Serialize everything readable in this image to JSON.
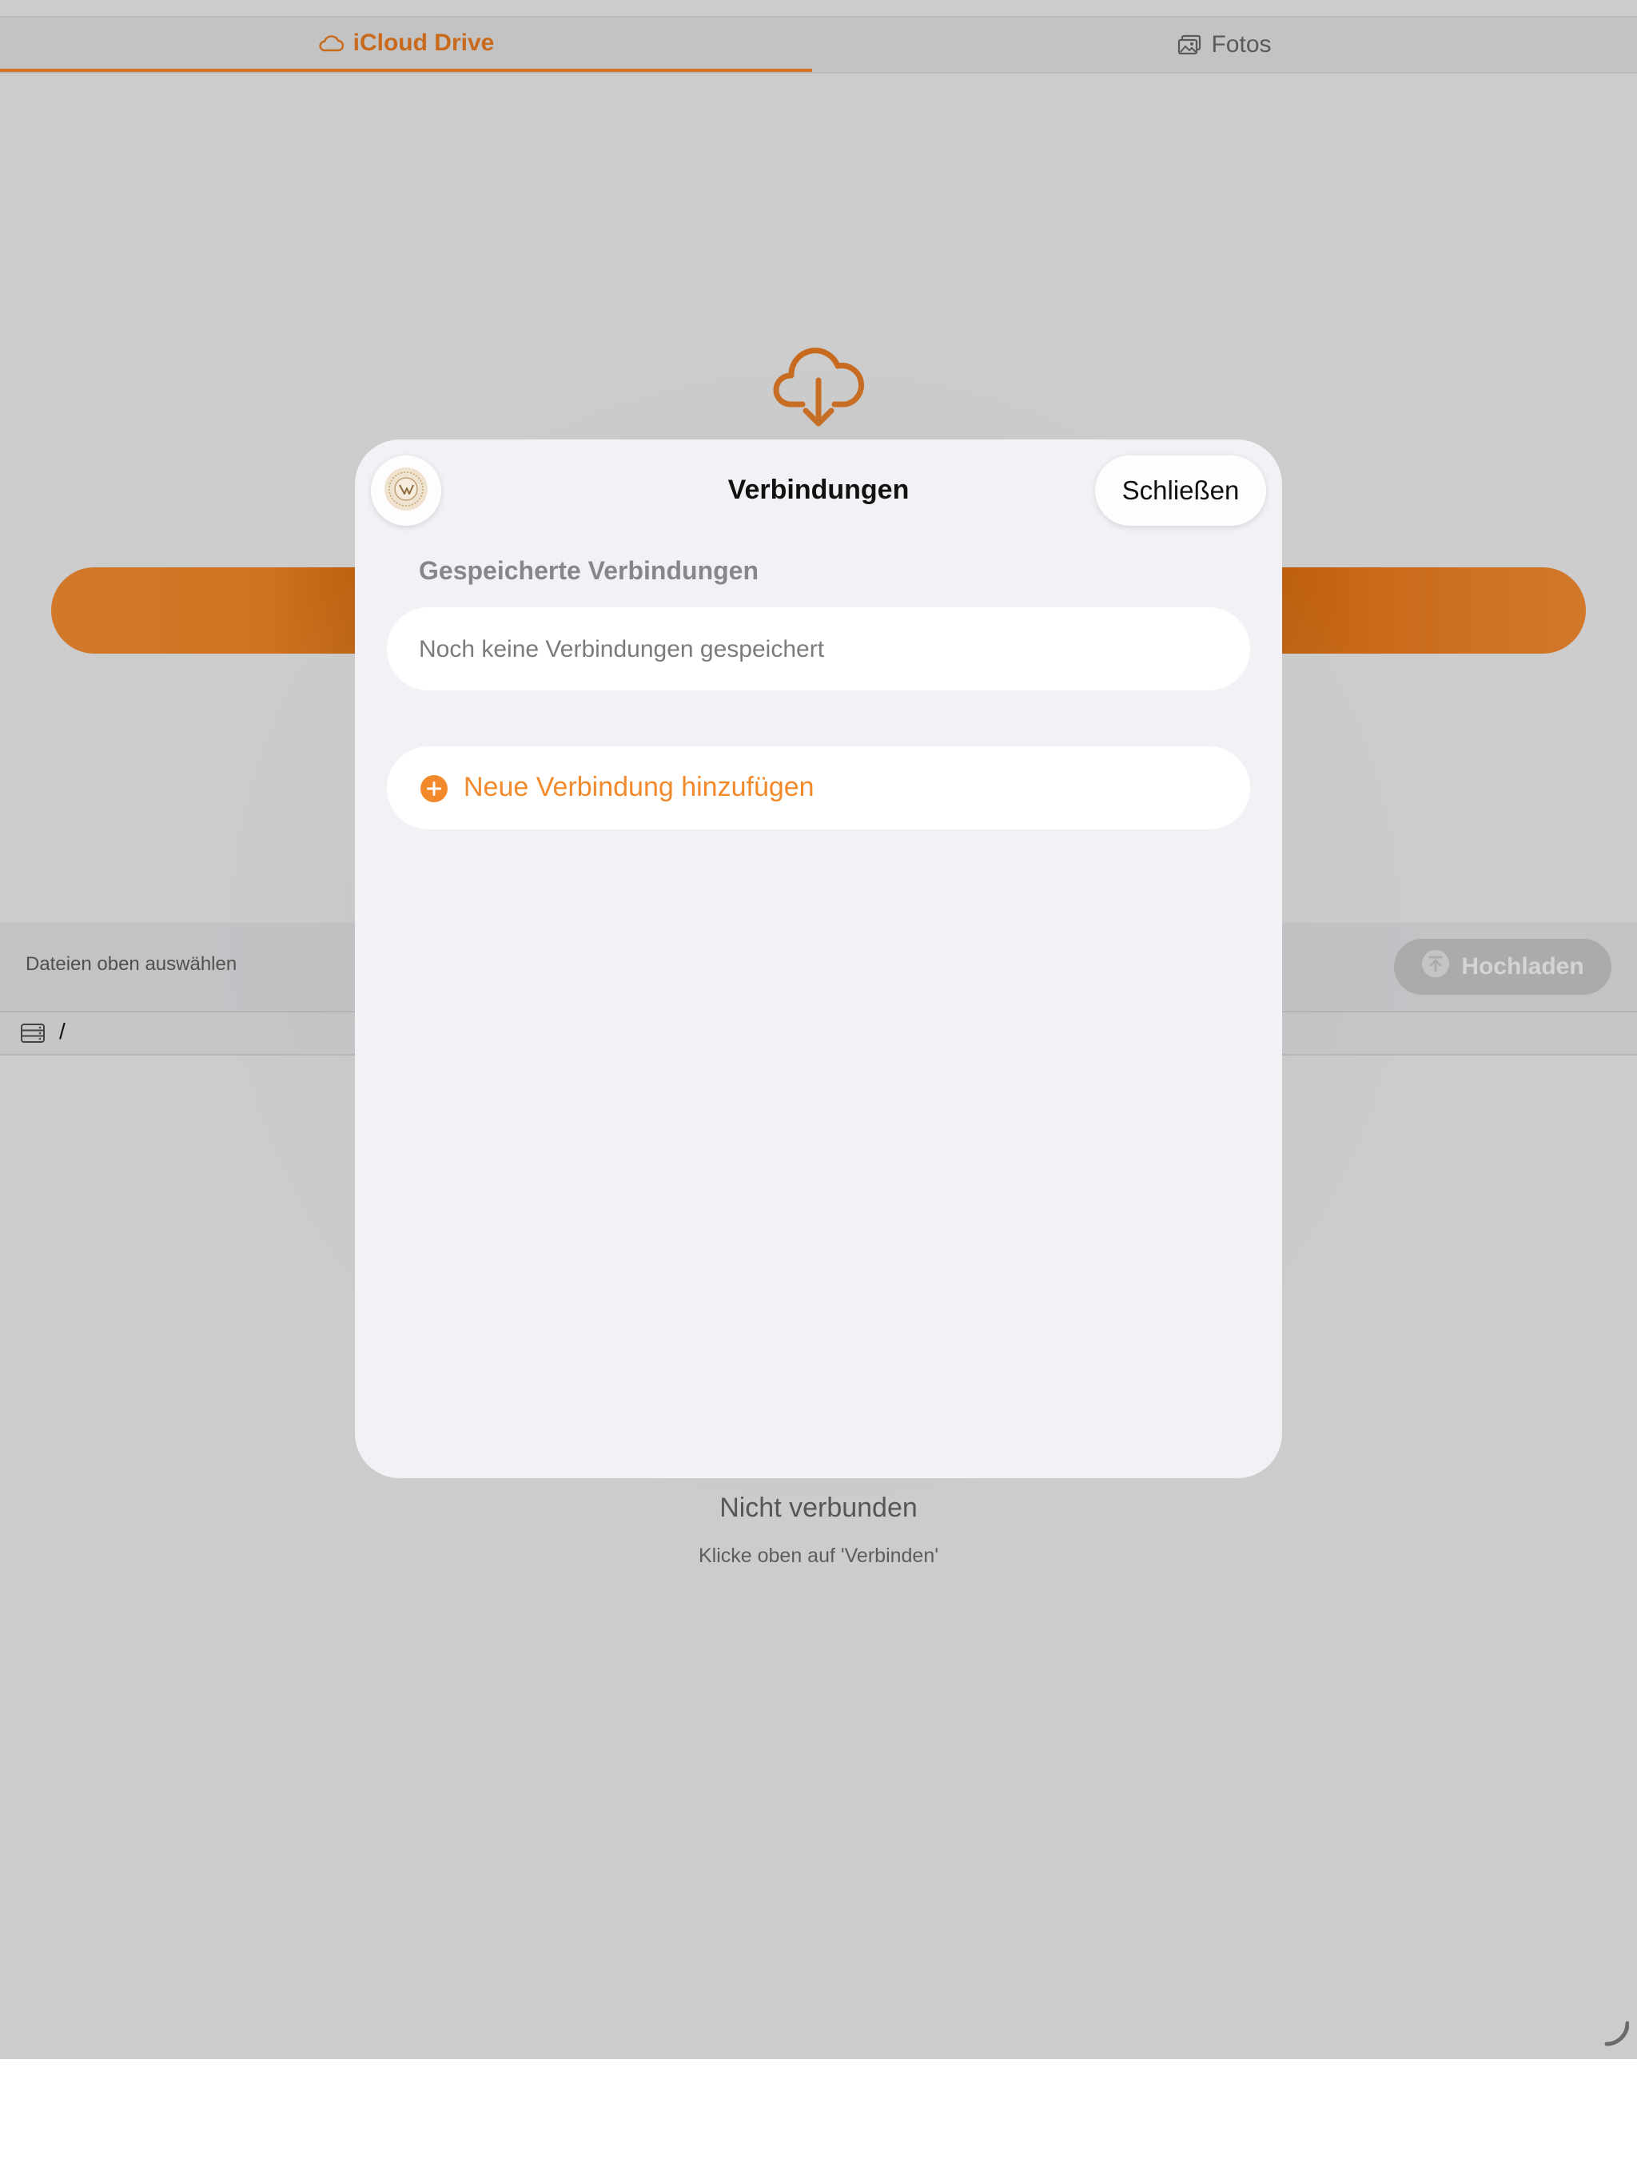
{
  "tabs": [
    {
      "label": "iCloud Drive",
      "icon": "cloud-icon",
      "active": true
    },
    {
      "label": "Fotos",
      "icon": "photos-icon",
      "active": false
    }
  ],
  "hero": {
    "icon": "cloud-download-icon"
  },
  "action_bar": {
    "hint": "Dateien oben auswählen",
    "upload_label": "Hochladen",
    "upload_icon": "upload-arrow-icon"
  },
  "path": {
    "icon": "server-icon",
    "value": "/"
  },
  "status": {
    "title": "Nicht verbunden",
    "subtitle": "Klicke oben auf 'Verbinden'"
  },
  "modal": {
    "title": "Verbindungen",
    "close_label": "Schließen",
    "logo": "app-logo-icon",
    "saved_section_label": "Gespeicherte Verbindungen",
    "empty_text": "Noch keine Verbindungen gespeichert",
    "add_label": "Neue Verbindung hinzufügen",
    "add_icon": "plus-circle-icon"
  },
  "colors": {
    "accent": "#f2892a",
    "accent_dark": "#c8691c",
    "backdrop": "#cccccc",
    "sheet": "#f2f2f6"
  }
}
